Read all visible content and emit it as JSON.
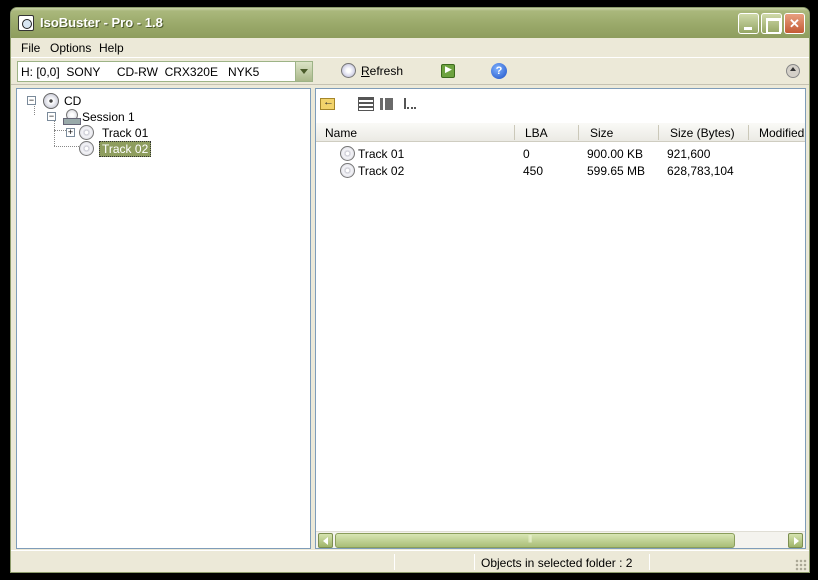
{
  "window": {
    "title": "IsoBuster - Pro - 1.8"
  },
  "menu": {
    "items": [
      "File",
      "Options",
      "Help"
    ]
  },
  "toolbar": {
    "drive": "H: [0,0]  SONY     CD-RW  CRX320E   NYK5",
    "refresh_label": "Refresh"
  },
  "tree": {
    "root": "CD",
    "session": "Session 1",
    "tracks": [
      "Track 01",
      "Track 02"
    ]
  },
  "list": {
    "columns": [
      "Name",
      "LBA",
      "Size",
      "Size (Bytes)",
      "Modified"
    ],
    "rows": [
      {
        "name": "Track 01",
        "lba": "0",
        "size": "900.00 KB",
        "bytes": "921,600"
      },
      {
        "name": "Track 02",
        "lba": "450",
        "size": "599.65 MB",
        "bytes": "628,783,104"
      }
    ]
  },
  "status": {
    "text": "Objects in selected folder : 2"
  },
  "colors": {
    "titlebar": "#9aa96a",
    "selection": "#8e9d5e"
  }
}
